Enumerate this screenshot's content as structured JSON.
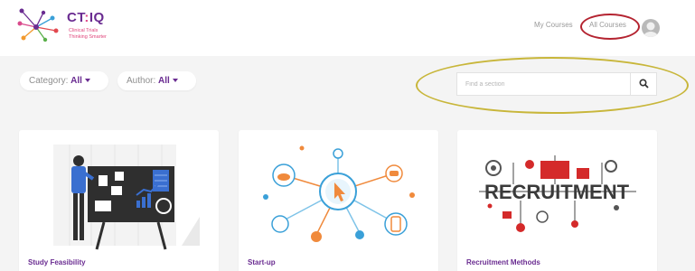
{
  "brand": {
    "name_part1": "CT",
    "name_sep": ":",
    "name_part2": "IQ",
    "tagline_line1": "Clinical Trials",
    "tagline_line2": "Thinking Smarter"
  },
  "nav": {
    "my_courses": "My Courses",
    "all_courses": "All Courses"
  },
  "filters": {
    "category_label": "Category:",
    "category_value": "All",
    "author_label": "Author:",
    "author_value": "All"
  },
  "search": {
    "placeholder": "Find a section",
    "icon": "search-icon"
  },
  "cards": [
    {
      "title": "Study Feasibility"
    },
    {
      "title": "Start-up"
    },
    {
      "title": "Recruitment Methods",
      "image_text": "RECRUITMENT"
    }
  ],
  "colors": {
    "brand_purple": "#6a2c91",
    "highlight_red": "#b42330",
    "highlight_gold": "#c8b63a"
  }
}
